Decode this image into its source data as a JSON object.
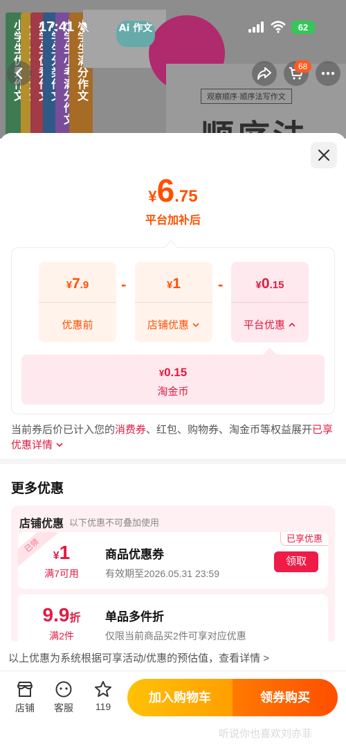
{
  "status_bar": {
    "time": "17:41",
    "battery": "62"
  },
  "background": {
    "book_spines": [
      "小学生优秀作文",
      "小学生作文大全",
      "小学生优秀作文",
      "小学生分类作文",
      "小学生小考满分作文",
      "小学生满分作文"
    ],
    "ai_bubble": "Ai 作文",
    "box_title": "顺序法",
    "box_subtitle": "观察顺序·顺序法写作文"
  },
  "header": {
    "cart_count": "68"
  },
  "summary": {
    "currency": "¥",
    "final_price_int": "6",
    "final_price_dec": ".75",
    "final_label": "平台加补后"
  },
  "breakdown": {
    "minus": "-",
    "items": [
      {
        "currency": "¥",
        "int": "7",
        "dec": ".9",
        "label": "优惠前"
      },
      {
        "currency": "¥",
        "int": "1",
        "dec": "",
        "label": "店铺优惠"
      },
      {
        "currency": "¥",
        "int": "0",
        "dec": ".15",
        "label": "平台优惠"
      }
    ],
    "coin": {
      "currency": "¥",
      "amount": "0.15",
      "label": "淘金币"
    }
  },
  "notice": {
    "part1": "当前券后价已计入您的",
    "highlight1": "消费券",
    "part2": "、红包、购物券、淘金币等权益展开",
    "link": "已享优惠详情"
  },
  "more_offers": {
    "title": "更多优惠",
    "shop_section_title": "店铺优惠",
    "shop_section_sub": "以下优惠不可叠加使用",
    "coupons": [
      {
        "ribbon": "已领",
        "tag": "已享优惠",
        "currency": "¥",
        "value": "1",
        "unit": "",
        "condition": "满7可用",
        "name": "商品优惠券",
        "desc": "有效期至2026.05.31 23:59",
        "button": "领取"
      },
      {
        "ribbon": "",
        "tag": "",
        "currency": "",
        "value": "9.9",
        "unit": "折",
        "condition": "满2件",
        "name": "单品多件折",
        "desc": "仅限当前商品买2件可享对应优惠",
        "button": ""
      }
    ],
    "estimate_note": "以上优惠为系统根据可享活动/优惠的预估值，查看详情 >"
  },
  "bottom_bar": {
    "tabs": [
      {
        "label": "店铺",
        "icon": "store-icon"
      },
      {
        "label": "客服",
        "icon": "customer-service-icon"
      },
      {
        "label": "119",
        "icon": "star-icon"
      }
    ],
    "add_to_cart": "加入购物车",
    "buy_with_coupon": "领券购买"
  },
  "watermark": "听说你也喜欢刘亦菲",
  "colors": {
    "accent_orange": "#ff5000",
    "accent_red": "#e21a43"
  }
}
